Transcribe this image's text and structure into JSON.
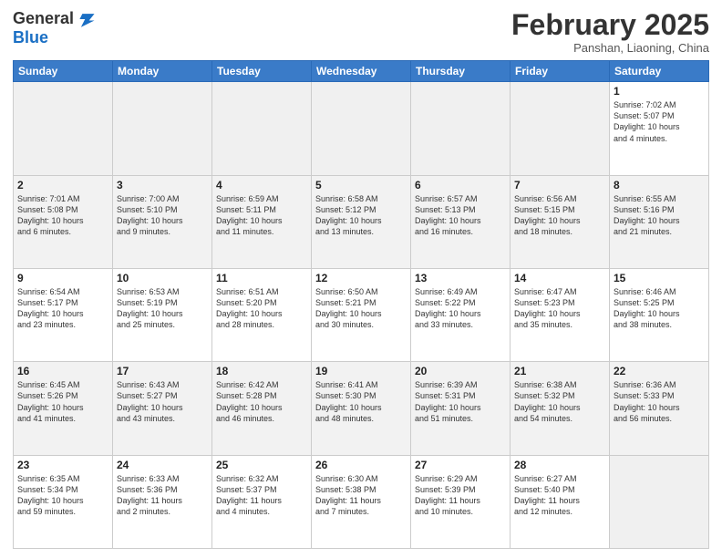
{
  "logo": {
    "line1": "General",
    "line2": "Blue"
  },
  "title": "February 2025",
  "subtitle": "Panshan, Liaoning, China",
  "weekdays": [
    "Sunday",
    "Monday",
    "Tuesday",
    "Wednesday",
    "Thursday",
    "Friday",
    "Saturday"
  ],
  "weeks": [
    [
      {
        "day": "",
        "info": ""
      },
      {
        "day": "",
        "info": ""
      },
      {
        "day": "",
        "info": ""
      },
      {
        "day": "",
        "info": ""
      },
      {
        "day": "",
        "info": ""
      },
      {
        "day": "",
        "info": ""
      },
      {
        "day": "1",
        "info": "Sunrise: 7:02 AM\nSunset: 5:07 PM\nDaylight: 10 hours\nand 4 minutes."
      }
    ],
    [
      {
        "day": "2",
        "info": "Sunrise: 7:01 AM\nSunset: 5:08 PM\nDaylight: 10 hours\nand 6 minutes."
      },
      {
        "day": "3",
        "info": "Sunrise: 7:00 AM\nSunset: 5:10 PM\nDaylight: 10 hours\nand 9 minutes."
      },
      {
        "day": "4",
        "info": "Sunrise: 6:59 AM\nSunset: 5:11 PM\nDaylight: 10 hours\nand 11 minutes."
      },
      {
        "day": "5",
        "info": "Sunrise: 6:58 AM\nSunset: 5:12 PM\nDaylight: 10 hours\nand 13 minutes."
      },
      {
        "day": "6",
        "info": "Sunrise: 6:57 AM\nSunset: 5:13 PM\nDaylight: 10 hours\nand 16 minutes."
      },
      {
        "day": "7",
        "info": "Sunrise: 6:56 AM\nSunset: 5:15 PM\nDaylight: 10 hours\nand 18 minutes."
      },
      {
        "day": "8",
        "info": "Sunrise: 6:55 AM\nSunset: 5:16 PM\nDaylight: 10 hours\nand 21 minutes."
      }
    ],
    [
      {
        "day": "9",
        "info": "Sunrise: 6:54 AM\nSunset: 5:17 PM\nDaylight: 10 hours\nand 23 minutes."
      },
      {
        "day": "10",
        "info": "Sunrise: 6:53 AM\nSunset: 5:19 PM\nDaylight: 10 hours\nand 25 minutes."
      },
      {
        "day": "11",
        "info": "Sunrise: 6:51 AM\nSunset: 5:20 PM\nDaylight: 10 hours\nand 28 minutes."
      },
      {
        "day": "12",
        "info": "Sunrise: 6:50 AM\nSunset: 5:21 PM\nDaylight: 10 hours\nand 30 minutes."
      },
      {
        "day": "13",
        "info": "Sunrise: 6:49 AM\nSunset: 5:22 PM\nDaylight: 10 hours\nand 33 minutes."
      },
      {
        "day": "14",
        "info": "Sunrise: 6:47 AM\nSunset: 5:23 PM\nDaylight: 10 hours\nand 35 minutes."
      },
      {
        "day": "15",
        "info": "Sunrise: 6:46 AM\nSunset: 5:25 PM\nDaylight: 10 hours\nand 38 minutes."
      }
    ],
    [
      {
        "day": "16",
        "info": "Sunrise: 6:45 AM\nSunset: 5:26 PM\nDaylight: 10 hours\nand 41 minutes."
      },
      {
        "day": "17",
        "info": "Sunrise: 6:43 AM\nSunset: 5:27 PM\nDaylight: 10 hours\nand 43 minutes."
      },
      {
        "day": "18",
        "info": "Sunrise: 6:42 AM\nSunset: 5:28 PM\nDaylight: 10 hours\nand 46 minutes."
      },
      {
        "day": "19",
        "info": "Sunrise: 6:41 AM\nSunset: 5:30 PM\nDaylight: 10 hours\nand 48 minutes."
      },
      {
        "day": "20",
        "info": "Sunrise: 6:39 AM\nSunset: 5:31 PM\nDaylight: 10 hours\nand 51 minutes."
      },
      {
        "day": "21",
        "info": "Sunrise: 6:38 AM\nSunset: 5:32 PM\nDaylight: 10 hours\nand 54 minutes."
      },
      {
        "day": "22",
        "info": "Sunrise: 6:36 AM\nSunset: 5:33 PM\nDaylight: 10 hours\nand 56 minutes."
      }
    ],
    [
      {
        "day": "23",
        "info": "Sunrise: 6:35 AM\nSunset: 5:34 PM\nDaylight: 10 hours\nand 59 minutes."
      },
      {
        "day": "24",
        "info": "Sunrise: 6:33 AM\nSunset: 5:36 PM\nDaylight: 11 hours\nand 2 minutes."
      },
      {
        "day": "25",
        "info": "Sunrise: 6:32 AM\nSunset: 5:37 PM\nDaylight: 11 hours\nand 4 minutes."
      },
      {
        "day": "26",
        "info": "Sunrise: 6:30 AM\nSunset: 5:38 PM\nDaylight: 11 hours\nand 7 minutes."
      },
      {
        "day": "27",
        "info": "Sunrise: 6:29 AM\nSunset: 5:39 PM\nDaylight: 11 hours\nand 10 minutes."
      },
      {
        "day": "28",
        "info": "Sunrise: 6:27 AM\nSunset: 5:40 PM\nDaylight: 11 hours\nand 12 minutes."
      },
      {
        "day": "",
        "info": ""
      }
    ]
  ]
}
